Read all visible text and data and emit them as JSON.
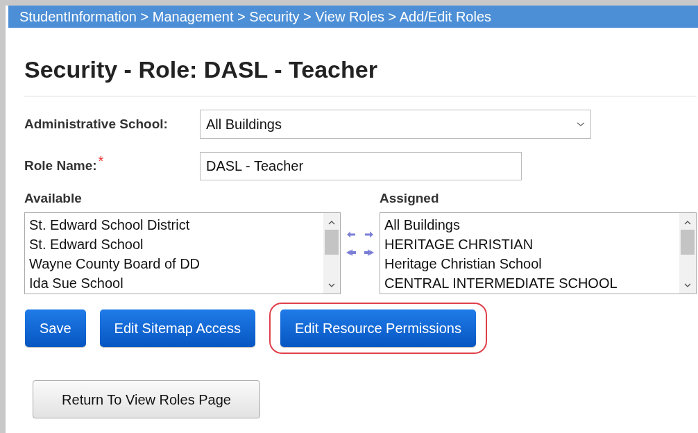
{
  "breadcrumb": "StudentInformation > Management > Security > View Roles > Add/Edit Roles",
  "title": "Security - Role: DASL - Teacher",
  "administrative_school": {
    "label": "Administrative School:",
    "value": "All Buildings"
  },
  "role_name": {
    "label": "Role Name:",
    "required_mark": "*",
    "value": "DASL - Teacher"
  },
  "available": {
    "label": "Available",
    "items": [
      "St. Edward School District",
      "St. Edward School",
      "Wayne County Board of DD",
      "Ida Sue School"
    ]
  },
  "assigned": {
    "label": "Assigned",
    "items": [
      "All Buildings",
      "HERITAGE CHRISTIAN",
      "Heritage Christian School",
      "CENTRAL INTERMEDIATE SCHOOL"
    ]
  },
  "buttons": [
    {
      "label": "Save",
      "highlighted": false
    },
    {
      "label": "Edit Sitemap Access",
      "highlighted": false
    },
    {
      "label": "Edit Resource Permissions",
      "highlighted": true
    }
  ],
  "return_button": "Return To View Roles Page"
}
